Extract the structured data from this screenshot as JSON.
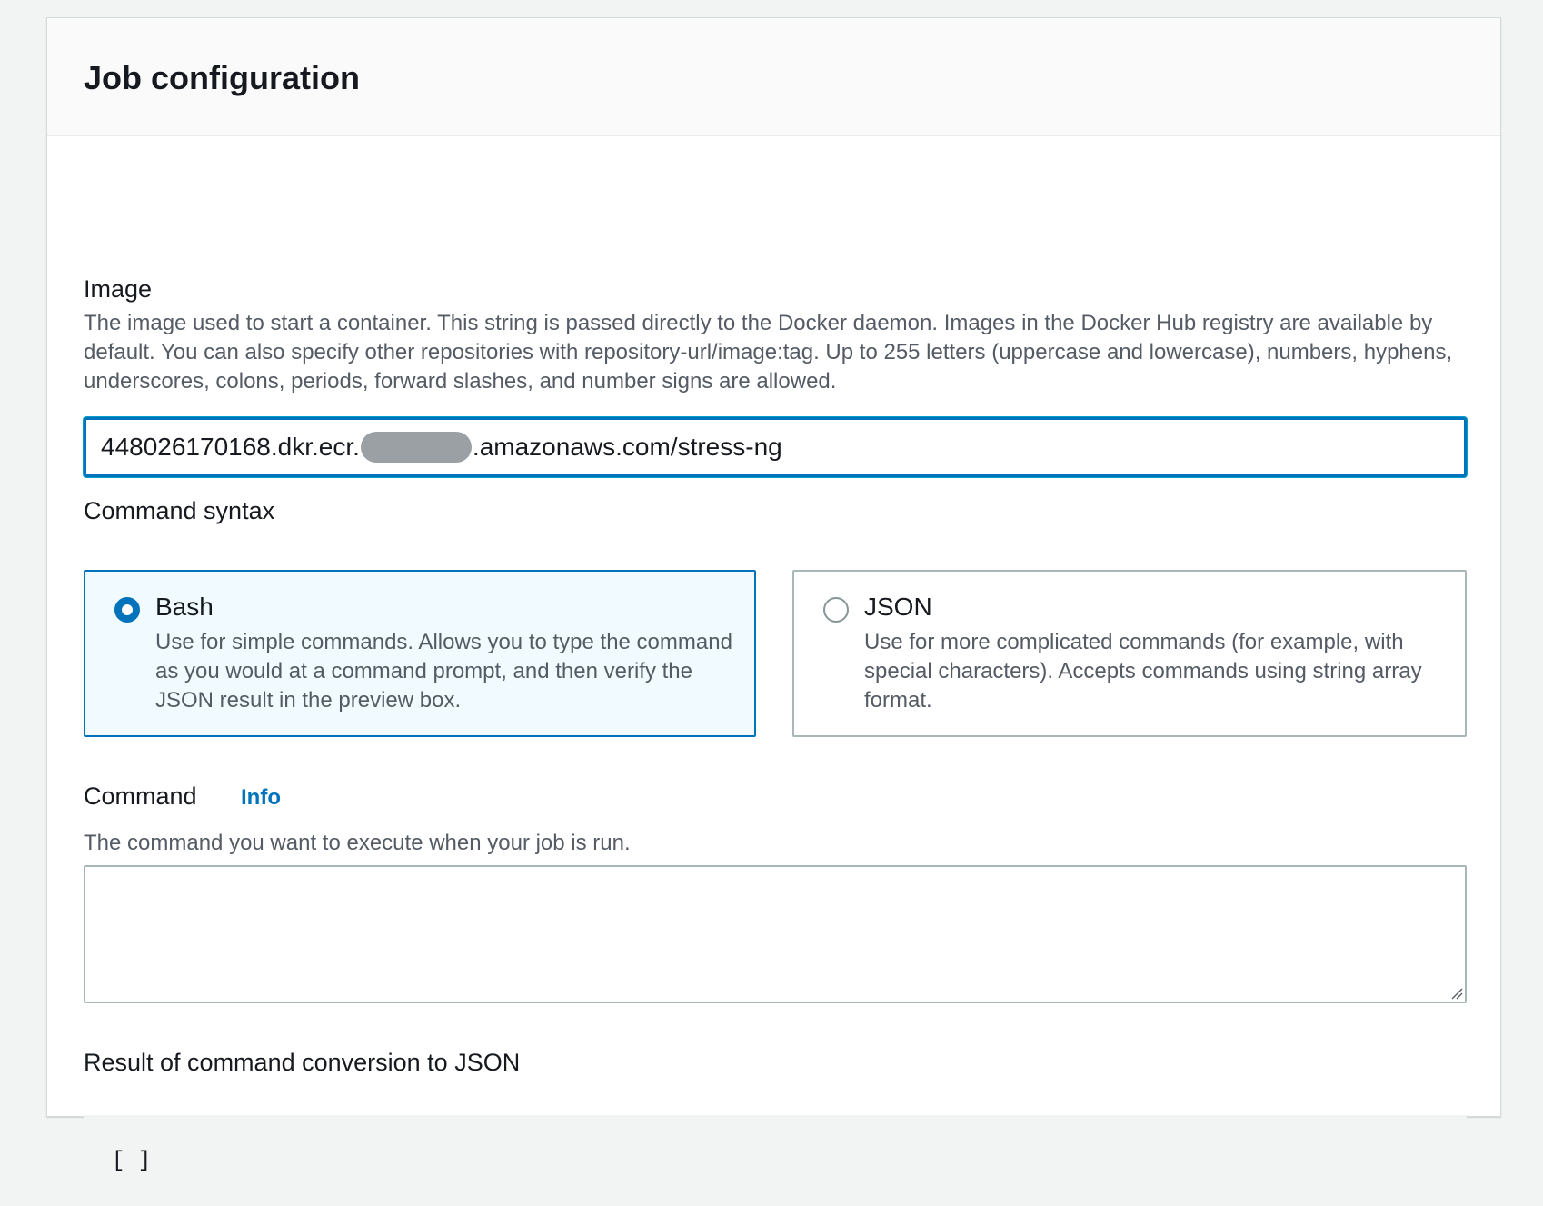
{
  "panel": {
    "title": "Job configuration"
  },
  "image_field": {
    "label": "Image",
    "description": "The image used to start a container. This string is passed directly to the Docker daemon. Images in the Docker Hub registry are available by default. You can also specify other repositories with repository-url/image:tag. Up to 255 letters (uppercase and lowercase), numbers, hyphens, underscores, colons, periods, forward slashes, and number signs are allowed.",
    "value_prefix": "448026170168.dkr.ecr.",
    "value_suffix": ".amazonaws.com/stress-ng"
  },
  "command_syntax": {
    "label": "Command syntax",
    "options": [
      {
        "title": "Bash",
        "description": "Use for simple commands. Allows you to type the command as you would at a command prompt, and then verify the JSON result in the preview box.",
        "selected": true
      },
      {
        "title": "JSON",
        "description": "Use for more complicated commands (for example, with special characters). Accepts commands using string array format.",
        "selected": false
      }
    ]
  },
  "command_field": {
    "label": "Command",
    "info_link": "Info",
    "description": "The command you want to execute when your job is run.",
    "value": ""
  },
  "result": {
    "label": "Result of command conversion to JSON",
    "value": "[ ]"
  },
  "colors": {
    "accent": "#0073bb",
    "selected_tile_bg": "#f1faff",
    "page_bg": "#f2f3f3"
  }
}
